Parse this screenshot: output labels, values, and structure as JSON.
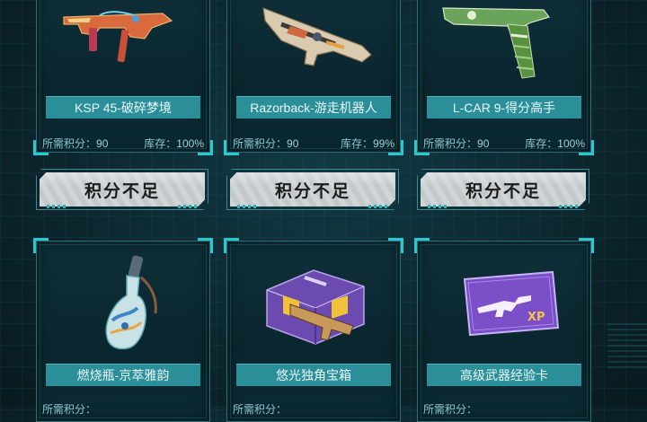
{
  "cost_label": "所需积分：",
  "stock_label": "库存：",
  "cards": [
    {
      "name": "KSP 45-破碎梦境",
      "cost": "90",
      "stock": "100%",
      "icon": "smg-icon"
    },
    {
      "name": "Razorback-游走机器人",
      "cost": "90",
      "stock": "99%",
      "icon": "rifle-icon"
    },
    {
      "name": "L-CAR 9-得分高手",
      "cost": "90",
      "stock": "100%",
      "icon": "pistol-icon"
    },
    {
      "name": "燃烧瓶-京萃雅韵",
      "cost": "",
      "stock": "",
      "icon": "molotov-icon"
    },
    {
      "name": "悠光独角宝箱",
      "cost": "",
      "stock": "",
      "icon": "crate-icon"
    },
    {
      "name": "高级武器经验卡",
      "cost": "",
      "stock": "",
      "icon": "xp-card-icon"
    }
  ],
  "buttons": [
    {
      "label": "积分不足"
    },
    {
      "label": "积分不足"
    },
    {
      "label": "积分不足"
    }
  ],
  "colors": {
    "accent": "#27c8d0",
    "name_bar": "#2a8f98",
    "button": "#c9cfd1",
    "xp_card": "#7a4fc8"
  }
}
